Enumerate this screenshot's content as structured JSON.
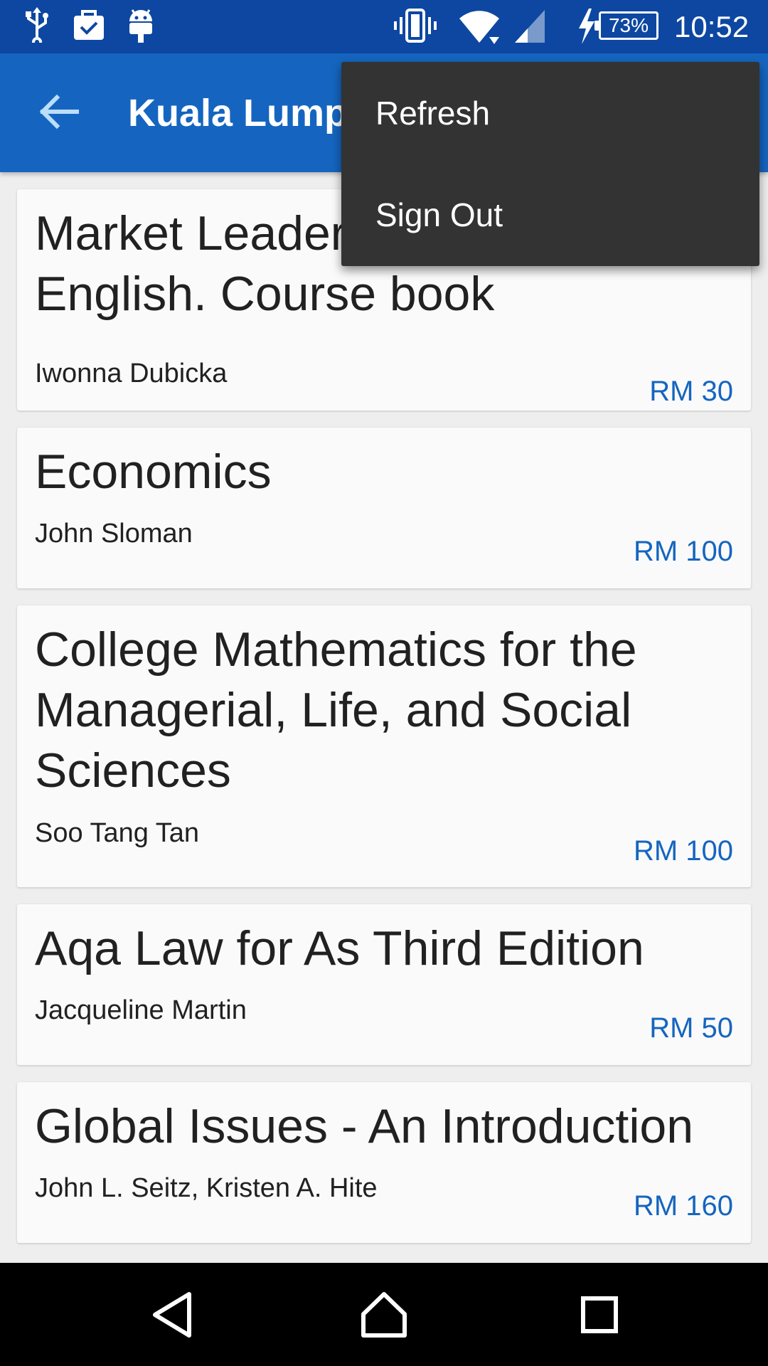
{
  "status_bar": {
    "battery": "73%",
    "time": "10:52",
    "icons": [
      "usb-icon",
      "shopping-bag-icon",
      "android-debug-icon",
      "vibrate-icon",
      "wifi-icon",
      "cell-signal-icon",
      "charging-icon",
      "battery-icon"
    ]
  },
  "app_bar": {
    "title": "Kuala Lumpur",
    "back_icon": "arrow-back-icon"
  },
  "menu": {
    "items": [
      "Refresh",
      "Sign Out"
    ]
  },
  "books": [
    {
      "title": "Market Leader Business English. Course book",
      "author": "Iwonna Dubicka",
      "price": "RM 30"
    },
    {
      "title": "Economics",
      "author": "John Sloman",
      "price": "RM 100"
    },
    {
      "title": "College Mathematics for the Managerial, Life, and Social Sciences",
      "author": "Soo Tang Tan",
      "price": "RM 100"
    },
    {
      "title": "Aqa Law for As Third Edition",
      "author": "Jacqueline Martin",
      "price": "RM 50"
    },
    {
      "title": "Global Issues - An Introduction",
      "author": "John L. Seitz, Kristen A. Hite",
      "price": "RM 160"
    }
  ],
  "nav_bar": {
    "icons": [
      "back-triangle-icon",
      "home-icon",
      "recents-icon"
    ]
  },
  "colors": {
    "status_bar": "#0d47a1",
    "app_bar": "#1565c0",
    "price": "#1565c0",
    "menu": "#333333",
    "background": "#eeeeee"
  }
}
